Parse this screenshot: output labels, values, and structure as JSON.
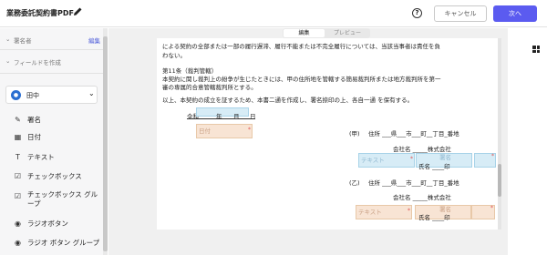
{
  "header": {
    "title": "業務委託契約書PDF",
    "cancel_label": "キャンセル",
    "next_label": "次へ",
    "help_icon": "?"
  },
  "sidebar": {
    "signers_heading": "署名者",
    "edit_label": "編集",
    "create_fields_heading": "フィールドを作成",
    "signer_name": "田中",
    "fields": [
      {
        "label": "署名",
        "icon": "signature-icon"
      },
      {
        "label": "日付",
        "icon": "calendar-icon"
      },
      {
        "label": "テキスト",
        "icon": "text-icon"
      },
      {
        "label": "チェックボックス",
        "icon": "checkbox-icon"
      },
      {
        "label": "チェックボックス グループ",
        "icon": "checkbox-group-icon"
      },
      {
        "label": "ラジオボタン",
        "icon": "radio-icon"
      },
      {
        "label": "ラジオ ボタン グループ",
        "icon": "radio-group-icon"
      }
    ]
  },
  "toolbar": {
    "tab_edit": "編集",
    "tab_preview": "プレビュー"
  },
  "document": {
    "lines": [
      "による契約の全部または一部の履行遅滞、履行不能または不完全履行については、当該当事者は責任を負",
      "わない。",
      "第11条（裁判管轄）",
      "本契約に関し裁判上の紛争が生じたときには、甲の住所地を管轄する簡易裁判所または地方裁判所を第一",
      "審の専属的合意管轄裁判所とする。",
      "以上、本契約の成立を証するため、本書二通を作成し、署名捺印の上、各自一通 を保有する。"
    ],
    "date_prefix": "令和",
    "year": "年",
    "month": "月",
    "day": "日",
    "date_placeholder": "日付",
    "party_a": {
      "label": "(甲)",
      "address": "住所 ___県___市___町__丁目_番地",
      "company": "会社名 _____株式会社",
      "name": "氏名 ____印",
      "text_placeholder": "テキスト",
      "name_placeholder": "署名"
    },
    "party_b": {
      "label": "(乙)",
      "address": "住所 ___県___市___町__丁目_番地",
      "company": "会社名 _____株式会社",
      "name": "氏名 ____印",
      "text_placeholder": "テキスト",
      "name_placeholder": "署名"
    }
  },
  "colors": {
    "accent": "#5b5bf0",
    "field_orange": "#f8e4d4",
    "field_blue": "#d7ecf6"
  }
}
